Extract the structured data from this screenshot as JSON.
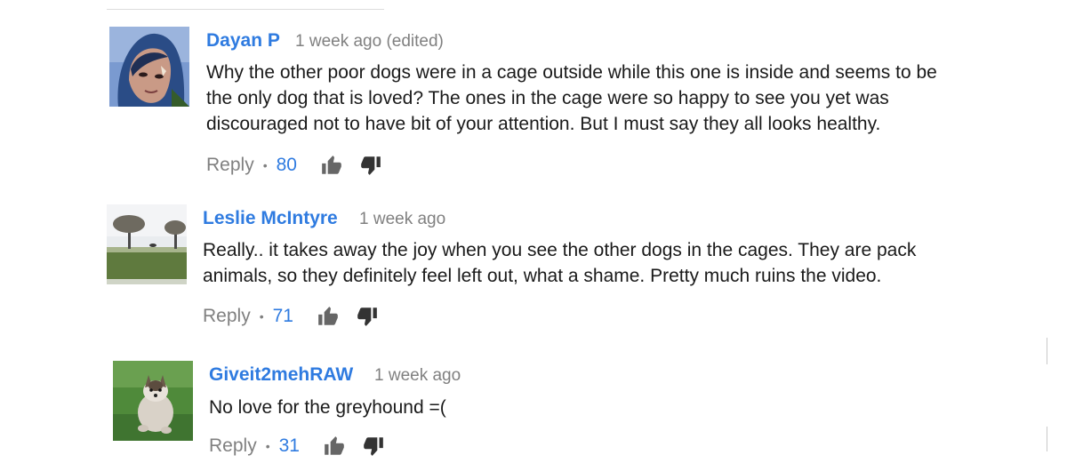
{
  "comments": [
    {
      "author": "Dayan P",
      "timestamp": "1 week ago (edited)",
      "text": "Why the other poor dogs were in a cage outside while this one is inside and seems to be\nthe only dog that is loved? The ones in the cage were so happy to see you yet was\ndiscouraged not to have bit of your attention. But I must say they all looks healthy.",
      "reply_label": "Reply",
      "separator": "•",
      "likes": "80"
    },
    {
      "author": "Leslie McIntyre",
      "timestamp": "1 week ago",
      "text": "Really.. it takes away the joy when you see the other dogs  in the cages. They are pack\nanimals, so they definitely feel left out, what a shame. Pretty much ruins the video.",
      "reply_label": "Reply",
      "separator": "•",
      "likes": "71"
    },
    {
      "author": "Giveit2mehRAW",
      "timestamp": "1 week ago",
      "text": "No love for the greyhound =(",
      "reply_label": "Reply",
      "separator": "•",
      "likes": "31"
    }
  ],
  "icons": {
    "like": "thumbs-up-icon",
    "dislike": "thumbs-down-icon"
  },
  "colors": {
    "author": "#2f7be0",
    "likes": "#2f7be0",
    "muted": "#808080",
    "text": "#1a1a1a"
  }
}
